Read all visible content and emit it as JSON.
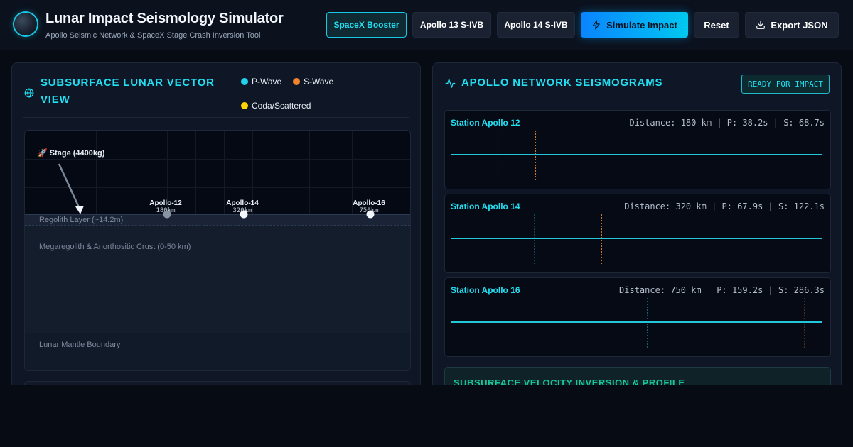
{
  "header": {
    "title": "Lunar Impact Seismology Simulator",
    "subtitle": "Apollo Seismic Network & SpaceX Stage Crash Inversion Tool",
    "presets": [
      {
        "label": "SpaceX Booster",
        "active": true
      },
      {
        "label": "Apollo 13 S-IVB",
        "active": false
      },
      {
        "label": "Apollo 14 S-IVB",
        "active": false
      }
    ],
    "simulate_label": "Simulate Impact",
    "reset_label": "Reset",
    "export_label": "Export JSON",
    "icons": {
      "logo": "moon-icon",
      "simulate": "lightning-icon",
      "export": "download-icon"
    }
  },
  "vector_view": {
    "title_line1": "SUBSURFACE LUNAR VECTOR",
    "title_line2": "VIEW",
    "icon": "globe-icon",
    "legend": [
      {
        "label": "P-Wave",
        "color": "#22d3ee"
      },
      {
        "label": "S-Wave",
        "color": "#f2852b"
      },
      {
        "label": "Coda/Scattered",
        "color": "#ffd400"
      }
    ],
    "stage_label": "🚀 Stage (4400kg)",
    "layers": {
      "regolith": "Regolith Layer (~14.2m)",
      "crust": "Megaregolith & Anorthositic Crust (0-50 km)",
      "mantle": "Lunar Mantle Boundary"
    },
    "stations": [
      {
        "name": "Apollo-12",
        "distance": "180km"
      },
      {
        "name": "Apollo-14",
        "distance": "320km"
      },
      {
        "name": "Apollo-16",
        "distance": "750km"
      }
    ]
  },
  "seismograms": {
    "title": "APOLLO NETWORK SEISMOGRAMS",
    "icon": "activity-icon",
    "status": "READY FOR IMPACT",
    "colors": {
      "trace": "#22c7da",
      "p_marker": "#22b8c8",
      "s_marker": "#d9782a"
    },
    "time_window_s": 300,
    "stations": [
      {
        "name": "Station Apollo 12",
        "info": "Distance: 180 km | P: 38.2s | S: 68.7s",
        "p": 38.2,
        "s": 68.7
      },
      {
        "name": "Station Apollo 14",
        "info": "Distance: 320 km | P: 67.9s | S: 122.1s",
        "p": 67.9,
        "s": 122.1
      },
      {
        "name": "Station Apollo 16",
        "info": "Distance: 750 km | P: 159.2s | S: 286.3s",
        "p": 159.2,
        "s": 286.3
      }
    ],
    "inversion_title": "SUBSURFACE VELOCITY INVERSION & PROFILE"
  }
}
